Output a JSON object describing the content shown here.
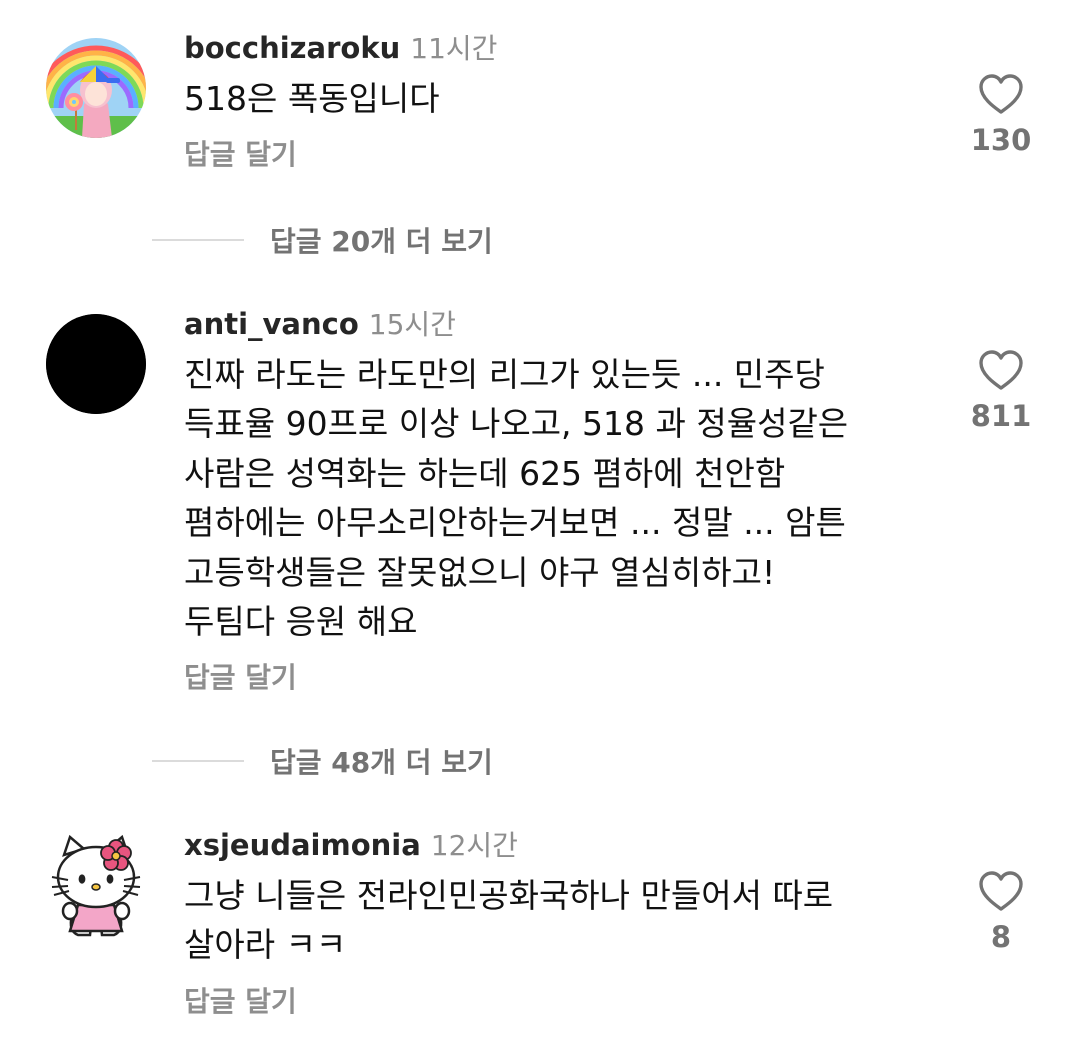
{
  "comments": [
    {
      "username": "bocchizaroku",
      "time": "11시간",
      "text": "518은 폭동입니다",
      "reply_label": "답글 달기",
      "like_count": "130",
      "avatar_icon": "anime-girl-rainbow-avatar",
      "view_replies": "답글 20개 더 보기"
    },
    {
      "username": "anti_vanco",
      "time": "15시간",
      "text": "진짜 라도는 라도만의 리그가 있는듯 ... 민주당\n득표율 90프로 이상 나오고, 518 과 정율성같은\n사람은 성역화는 하는데 625 폄하에 천안함\n폄하에는 아무소리안하는거보면 ... 정말 ... 암튼\n고등학생들은 잘못없으니 야구 열심히하고!\n두팀다 응원 해요",
      "reply_label": "답글 달기",
      "like_count": "811",
      "avatar_icon": "black-circle-avatar",
      "view_replies": "답글 48개 더 보기"
    },
    {
      "username": "xsjeudaimonia",
      "time": "12시간",
      "text": "그냥 니들은 전라인민공화국하나 만들어서 따로\n살아라 ㅋㅋ",
      "reply_label": "답글 달기",
      "like_count": "8",
      "avatar_icon": "hello-kitty-avatar"
    }
  ],
  "colors": {
    "text": "#111111",
    "username": "#262626",
    "muted": "#8e8e8e",
    "count": "#737373",
    "divider": "#dbdbdb"
  }
}
